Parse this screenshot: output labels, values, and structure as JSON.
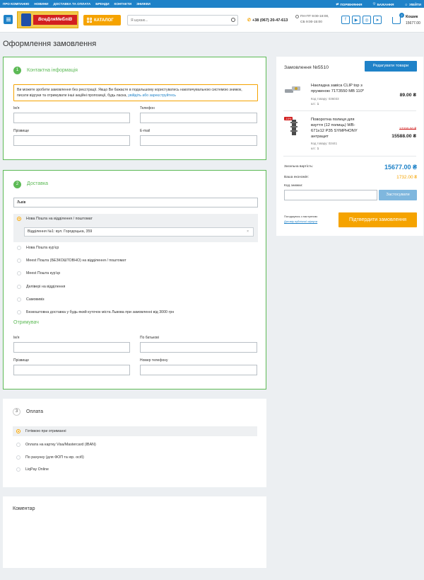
{
  "topbar": {
    "nav": [
      "ПРО КОМПАНІЮ",
      "НОВИНИ",
      "ДОСТАВКА ТА ОПЛАТА",
      "БРЕНДИ",
      "КОНТАКТИ",
      "ЗНИЖКИ"
    ],
    "compare": "ПОРІВНЯННЯ",
    "wishlist": "БАЖАННЯ",
    "login": "УВІЙТИ"
  },
  "header": {
    "logo_text": "ВсеДляМебліВ",
    "catalog": "КАТАЛОГ",
    "search_placeholder": "Я шукаю...",
    "phone": "+38 (067) 20-47-613",
    "hours_1": "ПН-ПТ 9:00-18:00,",
    "hours_2": "СБ 9:00-15:00",
    "cart_label": "Кошик",
    "cart_total": "15677.00",
    "cart_count": "2"
  },
  "page_title": "Оформлення замовлення",
  "contact": {
    "step": "1",
    "title": "Контактна інформація",
    "notice": "Ви можете зробити замовлення без реєстрації. Якщо Ви бажаєте в подальшому користуватись накопичувальною системою знижок, писати відгуки та отримувати інші акційні пропозиції, будь ласка,",
    "notice_link": "увійдіть або зареєструйтесь",
    "name_label": "Ім'я",
    "phone_label": "Телефон",
    "surname_label": "Прізвище",
    "email_label": "E-mail"
  },
  "delivery": {
    "step": "2",
    "title": "Доставка",
    "city": "Львів",
    "options": [
      "Нова Пошта на відділення / поштомат",
      "Нова Пошта кур'єр",
      "Meest Пошта (БЕЗКОШТОВНО) на відділення / поштомат",
      "Meest Пошта кур'єр",
      "Делівері на відділення",
      "Самовивіз",
      "Безкоштовна доставка у будь-який куточок міста Львова при замовленні від 3000 грн"
    ],
    "branch": "Відділення №1: вул. Городоцька, 359",
    "recipient_title": "Отримувач",
    "r_name_label": "Ім'я",
    "r_patronymic_label": "По батькові",
    "r_surname_label": "Прізвище",
    "r_phone_label": "Номер телефону"
  },
  "payment": {
    "step": "3",
    "title": "Оплата",
    "options": [
      "Готівкою при отриманні",
      "Оплата на картку Visa/Mastercard (IBAN)",
      "По рахунку (для ФОП та юр. осіб)",
      "LiqPay Online"
    ]
  },
  "comment": {
    "title": "Коментар"
  },
  "order": {
    "title": "Замовлення №5510",
    "edit_button": "Редагувати товари",
    "items": [
      {
        "title_1": "Накладна завіса CLIP top з",
        "title_2": "пружиною 71T3550 MB 110*",
        "code_label": "Код товару:",
        "code": "036033",
        "qty_label": "шт.:",
        "qty": "1",
        "price": "89.00 ₴"
      },
      {
        "title_1": "Поворотна полиця для",
        "title_2": "взуття (12 полиць) WB-",
        "title_3": "671x12 P35 SYMPHONY",
        "title_4": "антрацит",
        "code_label": "Код товару:",
        "code": "02441",
        "qty_label": "шт.:",
        "qty": "1",
        "sale": "-10%",
        "old_price": "17320.00 ₴",
        "price": "15588.00 ₴"
      }
    ],
    "total_label": "Загальна вартість:",
    "total": "15677.00 ₴",
    "savings_label": "Ваша економія:",
    "savings": "1732.00 ₴",
    "discount_label": "Код знижки:",
    "apply_button": "Застосувати",
    "agree_text": "Погоджуюсь з наступним:",
    "agree_link": "Договір публічної оферти",
    "confirm_button": "Підтвердити замовлення"
  },
  "colors": {
    "primary": "#1f82c8",
    "accent": "#f5a300",
    "active_border": "#5dba56",
    "sale": "#d21f1f"
  }
}
